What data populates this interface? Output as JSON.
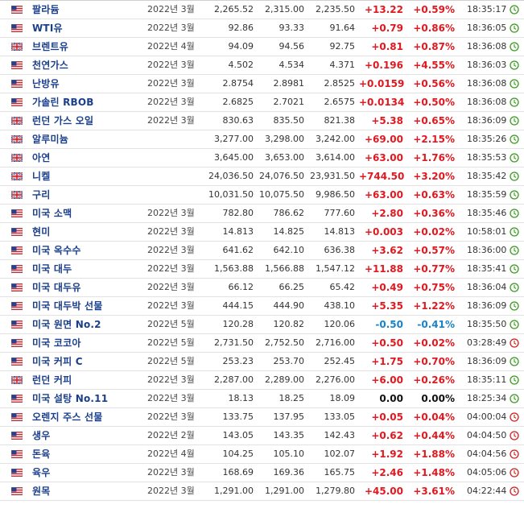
{
  "colors": {
    "positive": "#e0181f",
    "negative": "#1883c8",
    "neutral": "#111111",
    "open_clock": "#3a9a1f",
    "closed_clock": "#d02020",
    "name": "#1a3f8c"
  },
  "rows": [
    {
      "flag": "us-flag-icon",
      "name": "팔라듐",
      "month": "2022년 3월",
      "last": "2,265.52",
      "high": "2,315.00",
      "low": "2,235.50",
      "change": "+13.22",
      "pct": "+0.59%",
      "trend": "pos",
      "time": "18:35:17",
      "status": "open"
    },
    {
      "flag": "us-flag-icon",
      "name": "WTI유",
      "month": "2022년 3월",
      "last": "92.86",
      "high": "93.33",
      "low": "91.64",
      "change": "+0.79",
      "pct": "+0.86%",
      "trend": "pos",
      "time": "18:36:05",
      "status": "open"
    },
    {
      "flag": "uk-flag-icon",
      "name": "브렌트유",
      "month": "2022년 4월",
      "last": "94.09",
      "high": "94.56",
      "low": "92.75",
      "change": "+0.81",
      "pct": "+0.87%",
      "trend": "pos",
      "time": "18:36:08",
      "status": "open"
    },
    {
      "flag": "us-flag-icon",
      "name": "천연가스",
      "month": "2022년 3월",
      "last": "4.502",
      "high": "4.534",
      "low": "4.371",
      "change": "+0.196",
      "pct": "+4.55%",
      "trend": "pos",
      "time": "18:36:03",
      "status": "open"
    },
    {
      "flag": "us-flag-icon",
      "name": "난방유",
      "month": "2022년 3월",
      "last": "2.8754",
      "high": "2.8981",
      "low": "2.8525",
      "change": "+0.0159",
      "pct": "+0.56%",
      "trend": "pos",
      "time": "18:36:08",
      "status": "open"
    },
    {
      "flag": "us-flag-icon",
      "name": "가솔린 RBOB",
      "month": "2022년 3월",
      "last": "2.6825",
      "high": "2.7021",
      "low": "2.6575",
      "change": "+0.0134",
      "pct": "+0.50%",
      "trend": "pos",
      "time": "18:36:08",
      "status": "open"
    },
    {
      "flag": "uk-flag-icon",
      "name": "런던 가스 오일",
      "month": "2022년 3월",
      "last": "830.63",
      "high": "835.50",
      "low": "821.38",
      "change": "+5.38",
      "pct": "+0.65%",
      "trend": "pos",
      "time": "18:36:09",
      "status": "open"
    },
    {
      "flag": "uk-flag-icon",
      "name": "알루미늄",
      "month": "",
      "last": "3,277.00",
      "high": "3,298.00",
      "low": "3,242.00",
      "change": "+69.00",
      "pct": "+2.15%",
      "trend": "pos",
      "time": "18:35:26",
      "status": "open"
    },
    {
      "flag": "uk-flag-icon",
      "name": "아연",
      "month": "",
      "last": "3,645.00",
      "high": "3,653.00",
      "low": "3,614.00",
      "change": "+63.00",
      "pct": "+1.76%",
      "trend": "pos",
      "time": "18:35:53",
      "status": "open"
    },
    {
      "flag": "uk-flag-icon",
      "name": "니켈",
      "month": "",
      "last": "24,036.50",
      "high": "24,076.50",
      "low": "23,931.50",
      "change": "+744.50",
      "pct": "+3.20%",
      "trend": "pos",
      "time": "18:35:42",
      "status": "open"
    },
    {
      "flag": "uk-flag-icon",
      "name": "구리",
      "month": "",
      "last": "10,031.50",
      "high": "10,075.50",
      "low": "9,986.50",
      "change": "+63.00",
      "pct": "+0.63%",
      "trend": "pos",
      "time": "18:35:59",
      "status": "open"
    },
    {
      "flag": "us-flag-icon",
      "name": "미국 소맥",
      "month": "2022년 3월",
      "last": "782.80",
      "high": "786.62",
      "low": "777.60",
      "change": "+2.80",
      "pct": "+0.36%",
      "trend": "pos",
      "time": "18:35:46",
      "status": "open"
    },
    {
      "flag": "us-flag-icon",
      "name": "현미",
      "month": "2022년 3월",
      "last": "14.813",
      "high": "14.825",
      "low": "14.813",
      "change": "+0.003",
      "pct": "+0.02%",
      "trend": "pos",
      "time": "10:58:01",
      "status": "open"
    },
    {
      "flag": "us-flag-icon",
      "name": "미국 옥수수",
      "month": "2022년 3월",
      "last": "641.62",
      "high": "642.10",
      "low": "636.38",
      "change": "+3.62",
      "pct": "+0.57%",
      "trend": "pos",
      "time": "18:36:00",
      "status": "open"
    },
    {
      "flag": "us-flag-icon",
      "name": "미국 대두",
      "month": "2022년 3월",
      "last": "1,563.88",
      "high": "1,566.88",
      "low": "1,547.12",
      "change": "+11.88",
      "pct": "+0.77%",
      "trend": "pos",
      "time": "18:35:41",
      "status": "open"
    },
    {
      "flag": "us-flag-icon",
      "name": "미국 대두유",
      "month": "2022년 3월",
      "last": "66.12",
      "high": "66.25",
      "low": "65.42",
      "change": "+0.49",
      "pct": "+0.75%",
      "trend": "pos",
      "time": "18:36:04",
      "status": "open"
    },
    {
      "flag": "us-flag-icon",
      "name": "미국 대두박 선물",
      "month": "2022년 3월",
      "last": "444.15",
      "high": "444.90",
      "low": "438.10",
      "change": "+5.35",
      "pct": "+1.22%",
      "trend": "pos",
      "time": "18:36:09",
      "status": "open"
    },
    {
      "flag": "us-flag-icon",
      "name": "미국 원면 No.2",
      "month": "2022년 5월",
      "last": "120.28",
      "high": "120.82",
      "low": "120.06",
      "change": "-0.50",
      "pct": "-0.41%",
      "trend": "neg",
      "time": "18:35:50",
      "status": "open"
    },
    {
      "flag": "us-flag-icon",
      "name": "미국 코코아",
      "month": "2022년 5월",
      "last": "2,731.50",
      "high": "2,752.50",
      "low": "2,716.00",
      "change": "+0.50",
      "pct": "+0.02%",
      "trend": "pos",
      "time": "03:28:49",
      "status": "closed"
    },
    {
      "flag": "us-flag-icon",
      "name": "미국 커피 C",
      "month": "2022년 5월",
      "last": "253.23",
      "high": "253.70",
      "low": "252.45",
      "change": "+1.75",
      "pct": "+0.70%",
      "trend": "pos",
      "time": "18:36:09",
      "status": "open"
    },
    {
      "flag": "uk-flag-icon",
      "name": "런던 커피",
      "month": "2022년 3월",
      "last": "2,287.00",
      "high": "2,289.00",
      "low": "2,276.00",
      "change": "+6.00",
      "pct": "+0.26%",
      "trend": "pos",
      "time": "18:35:11",
      "status": "open"
    },
    {
      "flag": "us-flag-icon",
      "name": "미국 설탕 No.11",
      "month": "2022년 3월",
      "last": "18.13",
      "high": "18.25",
      "low": "18.09",
      "change": "0.00",
      "pct": "0.00%",
      "trend": "zero",
      "time": "18:25:34",
      "status": "open"
    },
    {
      "flag": "us-flag-icon",
      "name": "오렌지 주스 선물",
      "month": "2022년 3월",
      "last": "133.75",
      "high": "137.95",
      "low": "133.05",
      "change": "+0.05",
      "pct": "+0.04%",
      "trend": "pos",
      "time": "04:00:04",
      "status": "closed"
    },
    {
      "flag": "us-flag-icon",
      "name": "생우",
      "month": "2022년 2월",
      "last": "143.05",
      "high": "143.35",
      "low": "142.43",
      "change": "+0.62",
      "pct": "+0.44%",
      "trend": "pos",
      "time": "04:04:50",
      "status": "closed"
    },
    {
      "flag": "us-flag-icon",
      "name": "돈육",
      "month": "2022년 4월",
      "last": "104.25",
      "high": "105.10",
      "low": "102.07",
      "change": "+1.92",
      "pct": "+1.88%",
      "trend": "pos",
      "time": "04:04:56",
      "status": "closed"
    },
    {
      "flag": "us-flag-icon",
      "name": "육우",
      "month": "2022년 3월",
      "last": "168.69",
      "high": "169.36",
      "low": "165.75",
      "change": "+2.46",
      "pct": "+1.48%",
      "trend": "pos",
      "time": "04:05:06",
      "status": "closed"
    },
    {
      "flag": "us-flag-icon",
      "name": "원목",
      "month": "2022년 3월",
      "last": "1,291.00",
      "high": "1,291.00",
      "low": "1,279.80",
      "change": "+45.00",
      "pct": "+3.61%",
      "trend": "pos",
      "time": "04:22:44",
      "status": "closed"
    }
  ]
}
